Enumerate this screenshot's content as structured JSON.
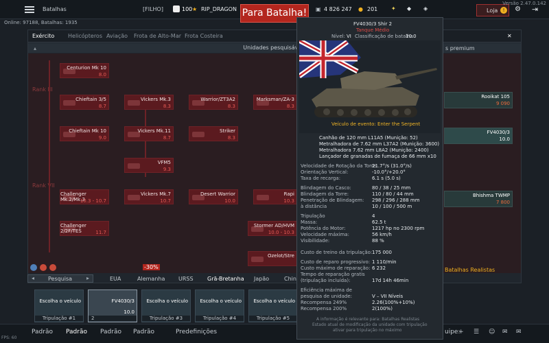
{
  "header": {
    "title": "Batalhas",
    "squad": "[FILHO]",
    "level": "100",
    "nick": "RIP_DRAGON",
    "battle_btn": "Para Batalha!",
    "silver": "4 826 247",
    "gold": "201",
    "shop": "Loja",
    "version": "Versão 2.47.0.142",
    "online": "Online: 97188, Batalhas: 1935"
  },
  "tabs": [
    "Exército",
    "Helicópteros",
    "Aviação",
    "Frota de Alto-Mar",
    "Frota Costeira"
  ],
  "panel_title": "Unidades pesquisáveis",
  "premium_title": "s premium",
  "ranks": [
    "Rank III",
    "Rank IV",
    "Rank VII",
    "Rank VIII"
  ],
  "tree": [
    {
      "name": "Centurion Mk 10",
      "br": "8.0"
    },
    {
      "name": "Chieftain 3/5",
      "br": "8.7"
    },
    {
      "name": "Vickers Mk.3",
      "br": "8.3"
    },
    {
      "name": "Warrior/ZT3A2",
      "br": "8.3"
    },
    {
      "name": "Marksman/ZA-3",
      "br": "8.3"
    },
    {
      "name": "Chieftain Mk 10",
      "br": "9.0"
    },
    {
      "name": "Vickers Mk.11",
      "br": "8.7"
    },
    {
      "name": "Striker",
      "br": "8.3"
    },
    {
      "name": "VFM5",
      "br": "9.3"
    },
    {
      "name": "Challenger Mk.2/Mk.3",
      "br": "10.3 - 10.7"
    },
    {
      "name": "Vickers Mk.7",
      "br": "10.7"
    },
    {
      "name": "Desert Warrior",
      "br": "10.0"
    },
    {
      "name": "Rapi",
      "br": "10.3"
    },
    {
      "name": "Challenger 2/2F/TES",
      "br": "11.7"
    },
    {
      "name": "Stormer AD/HVM",
      "br": "10.0 - 10.3"
    },
    {
      "name": "Ozelot/Stre",
      "br": ""
    }
  ],
  "premium": [
    {
      "name": "Rooikat 105",
      "price": "9 090",
      "br": "9.7"
    },
    {
      "name": "FV4030/3",
      "price": "",
      "br": "10.0"
    },
    {
      "name": "Bhishma TWMP",
      "price": "7 800",
      "br": "10.7"
    }
  ],
  "tooltip": {
    "name": "FV4030/3 Shir 2",
    "cls": "Tanque Médio",
    "nivel_l": "Nível:",
    "nivel": "VI",
    "class_l": "Classificação de batalha:",
    "class_v": "10.0",
    "event": "Veículo de evento: Enter the Serpent",
    "weapons": [
      "Canhão de 120 mm L11A5 (Munição: 52)",
      "Metralhadora de 7.62 mm L37A2 (Munição: 3600)",
      "Metralhadora 7.62 mm L8A2 (Munição: 2400)",
      "Lançador de granadas de fumaça de 66 mm x10"
    ],
    "stats": [
      {
        "l": "Velocidade de Rotação da Torre:",
        "v": "21.7°/s (31.0°/s)"
      },
      {
        "l": "Orientação Vertical:",
        "v": "-10.0°/+20.0°"
      },
      {
        "l": "Taxa de recarga:",
        "v": "6.1 s (5.0 s)"
      },
      {
        "l": "Blindagem do Casco:",
        "v": "80 / 38 / 25 mm"
      },
      {
        "l": "Blindagem da Torre:",
        "v": "110 / 80 / 44 mm"
      },
      {
        "l": "Penetração de Blindagem:",
        "v": "298 / 296 / 288 mm"
      },
      {
        "l": "à distância",
        "v": "10 / 100 / 500 m"
      },
      {
        "l": "Tripulação",
        "v": "4"
      },
      {
        "l": "Massa:",
        "v": "62.5 t"
      },
      {
        "l": "Potência do Motor:",
        "v": "1217 hp no 2300 rpm"
      },
      {
        "l": "Velocidade máxima:",
        "v": "56 km/h"
      },
      {
        "l": "Visibilidade:",
        "v": "88 %"
      },
      {
        "l": "Custo de treino da tripulação:",
        "v": "175 000"
      },
      {
        "l": "Custo de reparo progressivo:",
        "v": "1 110/min"
      },
      {
        "l": "Custo máximo de reparação:",
        "v": "6 232"
      },
      {
        "l": "Tempo de reparação gratis (tripulação incluída):",
        "v": "17d 14h 46min"
      },
      {
        "l": "Eficiência máxima de pesquisa de unidade:",
        "v": "V – VII Níveis"
      },
      {
        "l": "Recompensa 249%",
        "v": "2.26(100%+10%)"
      },
      {
        "l": "Recompensa 200%",
        "v": "2(100%)"
      }
    ],
    "foot1": "A informação é relevante para: Batalhas Realistas",
    "foot2": "Estado atual de modificação da unidade com tripulação",
    "foot3": "ativar para tripulação no máximo"
  },
  "bottom": {
    "search": "Pesquisa",
    "nations": [
      "EUA",
      "Alemanha",
      "URSS",
      "Grã-Bretanha",
      "Japão",
      "China"
    ],
    "discount": "-30%",
    "mode": "Batalhas Realistas"
  },
  "crew": [
    {
      "label": "Tripulação #1",
      "title": "Escolha o veículo"
    },
    {
      "label": "2",
      "title": "FV4030/3",
      "br": "10.0"
    },
    {
      "label": "Tripulação #3",
      "title": "Escolha o veículo"
    },
    {
      "label": "Tripulação #4",
      "title": "Escolha o veículo"
    },
    {
      "label": "Tripulação #5",
      "title": "Escolha o veículo"
    }
  ],
  "footer": [
    "Padrão",
    "Padrão",
    "Padrão",
    "Padrão",
    "Predefinições"
  ],
  "footer_right": "uipe:",
  "fps": "FPS: 60"
}
